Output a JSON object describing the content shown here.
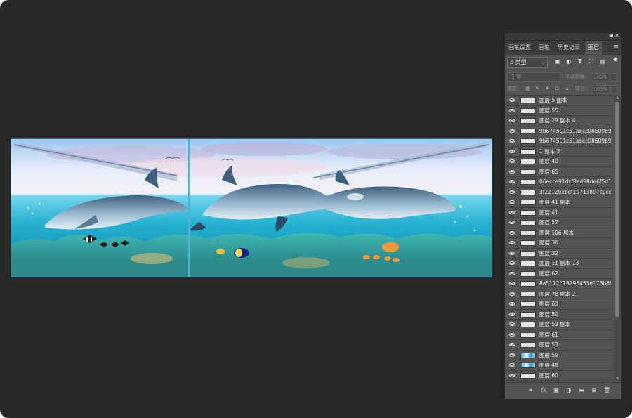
{
  "panel": {
    "tabs": [
      {
        "label": "画笔设置"
      },
      {
        "label": "画笔"
      },
      {
        "label": "历史记录"
      },
      {
        "label": "图层",
        "active": true
      }
    ],
    "filter": {
      "label": "ρ 类型"
    },
    "blend_mode": "正常",
    "opacity_label": "不透明度:",
    "opacity_value": "100%",
    "lock_label": "锁定:",
    "fill_label": "填充:",
    "fill_value": "100%",
    "layers": [
      {
        "name": "图层 5 副本"
      },
      {
        "name": "图层 55"
      },
      {
        "name": "图层 29 副本 4"
      },
      {
        "name": "9b674591c51aecc0860969..."
      },
      {
        "name": "9b674591c51aecc0860969..."
      },
      {
        "name": "1 副本 3"
      },
      {
        "name": "图层 40"
      },
      {
        "name": "图层 65"
      },
      {
        "name": "06ecce91dcf0ad98de6f5d1..."
      },
      {
        "name": "3f221292bcf19713807c9cd..."
      },
      {
        "name": "图层 41 副本"
      },
      {
        "name": "图层 41"
      },
      {
        "name": "图层 57"
      },
      {
        "name": "图层 106 副本"
      },
      {
        "name": "图层 38"
      },
      {
        "name": "图层 32"
      },
      {
        "name": "图层 11 副本 13"
      },
      {
        "name": "图层 62"
      },
      {
        "name": "8a5172618295453e376b8f..."
      },
      {
        "name": "图层 78 副本 2"
      },
      {
        "name": "图层 63"
      },
      {
        "name": "图层 50"
      },
      {
        "name": "图层 53 副本"
      },
      {
        "name": "图层 61"
      },
      {
        "name": "图层 53"
      },
      {
        "name": "图层 59",
        "thumb": "img"
      },
      {
        "name": "图层 48",
        "thumb": "img"
      },
      {
        "name": "图层 60"
      }
    ]
  },
  "colors": {
    "app_background": "#282828",
    "panel_background": "#535353",
    "water": "#2aa8c8"
  }
}
